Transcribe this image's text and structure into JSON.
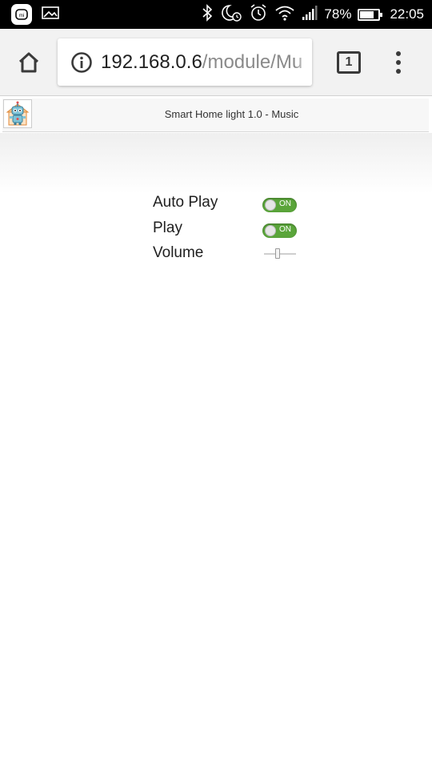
{
  "status_bar": {
    "battery": "78%",
    "time": "22:05",
    "battery_level": 0.78,
    "icons": [
      "mi-app-icon",
      "image-icon",
      "bluetooth-icon",
      "night-mode-icon",
      "alarm-icon",
      "wifi-icon",
      "signal-icon",
      "battery-icon"
    ]
  },
  "browser": {
    "url_host": "192.168.0.6",
    "url_path": "/module/Mu",
    "tab_count": "1",
    "icons": [
      "home-icon",
      "info-icon",
      "tabs-icon",
      "menu-icon"
    ]
  },
  "app": {
    "title": "Smart Home light 1.0 - Music",
    "logo": "robot-logo"
  },
  "controls": {
    "auto_play": {
      "label": "Auto Play",
      "state": "ON",
      "color": "#5aa53a"
    },
    "play": {
      "label": "Play",
      "state": "ON",
      "color": "#5aa53a"
    },
    "volume": {
      "label": "Volume",
      "level": 0.42
    }
  }
}
